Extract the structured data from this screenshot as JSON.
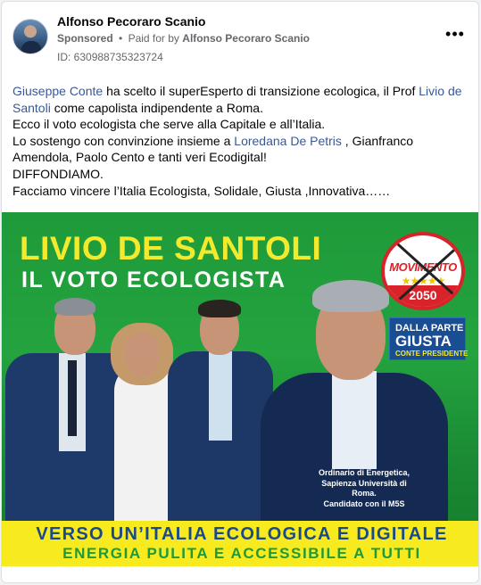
{
  "post": {
    "page_name": "Alfonso Pecoraro Scanio",
    "sponsored_label": "Sponsored",
    "separator": "•",
    "paid_for_prefix": "Paid for by",
    "paid_for_by": "Alfonso Pecoraro Scanio",
    "ad_id": "ID: 630988735323724",
    "more_label": "•••"
  },
  "text": {
    "l1_link1": "Giuseppe Conte",
    "l1_mid": " ha scelto il superEsperto di transizione ecologica, il Prof ",
    "l1_link2": "Livio de",
    "l2_link2": "Santoli",
    "l2_rest": " come capolista indipendente a Roma.",
    "l3": "Ecco il voto ecologista che serve alla Capitale e all’Italia.",
    "l4_pre": "Lo sostengo con convinzione insieme a ",
    "l4_link": "Loredana De Petris",
    "l4_post": " , Gianfranco",
    "l5": "Amendola, Paolo Cento e tanti veri Ecodigital!",
    "l6": "DIFFONDIAMO.",
    "l7": "Facciamo vincere l’Italia Ecologista, Solidale, Giusta ,Innovativa……"
  },
  "creative": {
    "headline": "LIVIO DE SANTOLI",
    "subheadline": "IL VOTO ECOLOGISTA",
    "logo_word": "MOVIMENTO",
    "logo_year": "2050",
    "badge_line1": "DALLA PARTE",
    "badge_line2": "GIUSTA",
    "badge_line3": "CONTE PRESIDENTE",
    "caption_line1": "Ordinario di Energetica,",
    "caption_line2": "Sapienza Università di Roma.",
    "caption_line3": "Candidato con il M5S",
    "banner_line1": "VERSO UN’ITALIA ECOLOGICA E DIGITALE",
    "banner_line2": "ENERGIA PULITA E ACCESSIBILE A TUTTI"
  },
  "colors": {
    "link": "#385898",
    "creative_green": "#1f9a3a",
    "headline_yellow": "#f4ea2d",
    "banner_yellow": "#f7ea1e",
    "banner_blue": "#1a4a8a"
  }
}
